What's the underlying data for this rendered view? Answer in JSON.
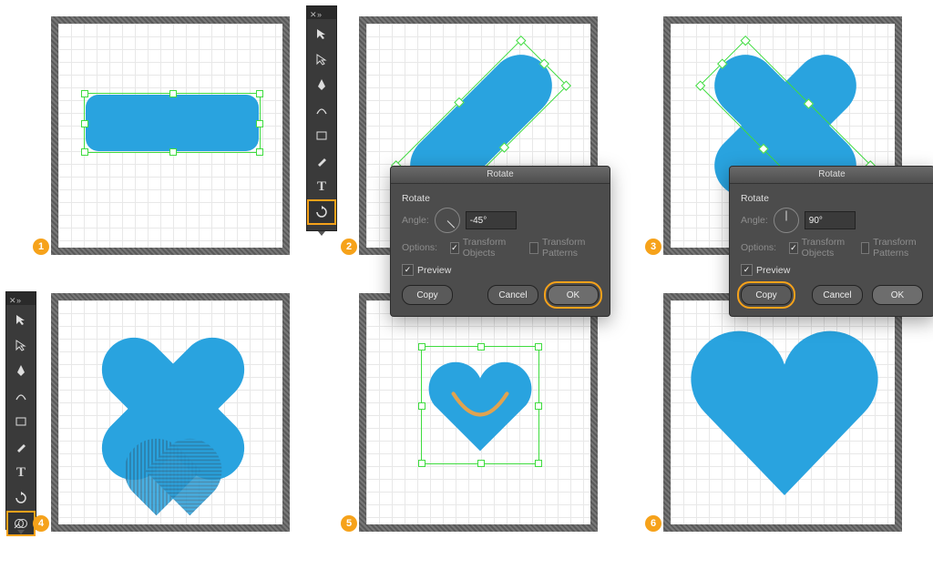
{
  "steps": {
    "1": "1",
    "2": "2",
    "3": "3",
    "4": "4",
    "5": "5",
    "6": "6"
  },
  "rotate": {
    "title": "Rotate",
    "section": "Rotate",
    "angle_label": "Angle:",
    "options_label": "Options:",
    "transform_objects": "Transform Objects",
    "transform_patterns": "Transform Patterns",
    "preview": "Preview",
    "copy": "Copy",
    "cancel": "Cancel",
    "ok": "OK"
  },
  "dialog2": {
    "angle": "-45°"
  },
  "dialog3": {
    "angle": "90°"
  },
  "tools": {
    "selection": "selection",
    "direct_selection": "direct-selection",
    "pen": "pen",
    "curvature": "curvature",
    "rectangle": "rectangle",
    "paintbrush": "paintbrush",
    "type": "type",
    "rotate": "rotate",
    "shape_builder": "shape-builder"
  }
}
